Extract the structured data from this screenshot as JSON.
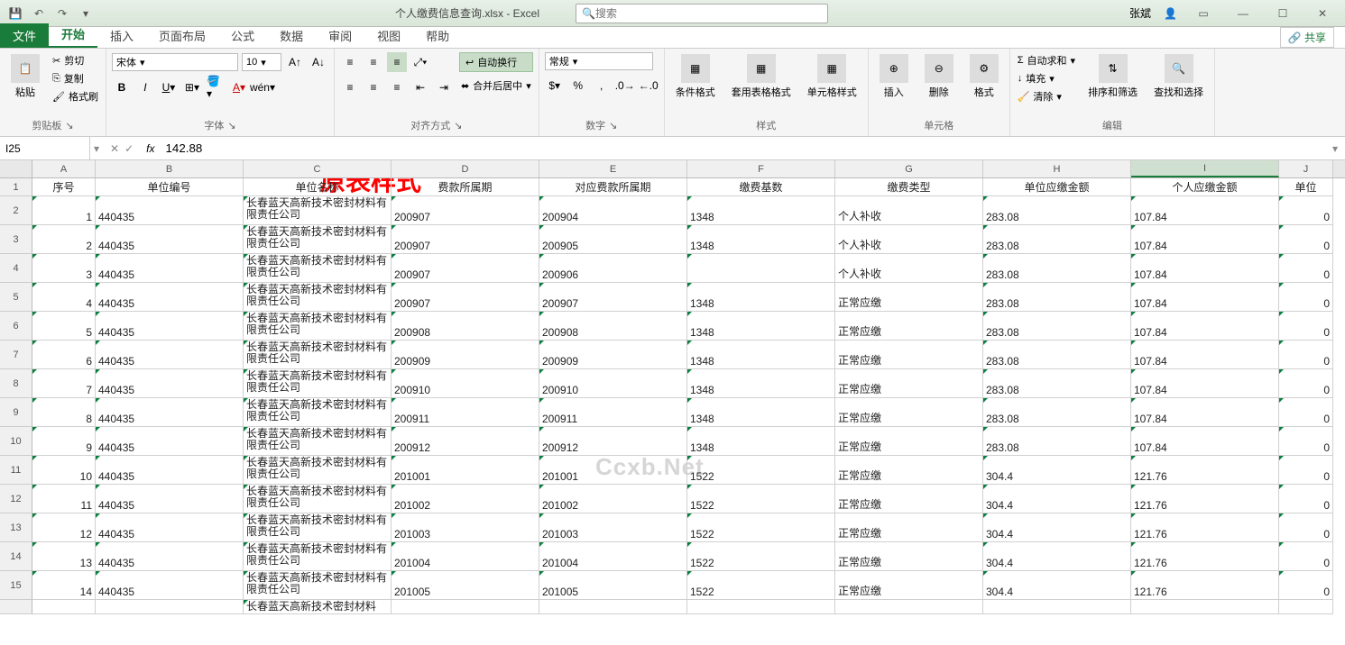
{
  "title": "个人缴费信息查询.xlsx - Excel",
  "search_placeholder": "搜索",
  "user_name": "张斌",
  "annotation": "原表样式",
  "watermark": "Ccxb.Net",
  "name_box": "I25",
  "formula_value": "142.88",
  "tabs": {
    "file": "文件",
    "home": "开始",
    "insert": "插入",
    "layout": "页面布局",
    "formula": "公式",
    "data": "数据",
    "review": "审阅",
    "view": "视图",
    "help": "帮助"
  },
  "share": "共享",
  "clipboard": {
    "paste": "粘贴",
    "cut": "剪切",
    "copy": "复制",
    "painter": "格式刷",
    "label": "剪贴板"
  },
  "font": {
    "name": "宋体",
    "size": "10",
    "label": "字体"
  },
  "align": {
    "wrap": "自动换行",
    "merge": "合并后居中",
    "label": "对齐方式"
  },
  "number": {
    "format": "常规",
    "label": "数字"
  },
  "styles": {
    "cond": "条件格式",
    "table": "套用表格格式",
    "cell": "单元格样式",
    "label": "样式"
  },
  "cells": {
    "insert": "插入",
    "delete": "删除",
    "format": "格式",
    "label": "单元格"
  },
  "editing": {
    "sum": "自动求和",
    "fill": "填充",
    "clear": "清除",
    "sort": "排序和筛选",
    "find": "查找和选择",
    "label": "编辑"
  },
  "columns": [
    "A",
    "B",
    "C",
    "D",
    "E",
    "F",
    "G",
    "H",
    "I",
    "J"
  ],
  "headers": {
    "A": "序号",
    "B": "单位编号",
    "C": "单位名称",
    "D": "费款所属期",
    "E": "对应费款所属期",
    "F": "缴费基数",
    "G": "缴费类型",
    "H": "单位应缴金额",
    "I": "个人应缴金额",
    "J": "单位"
  },
  "company": "长春蓝天高新技术密封材料有限责任公司",
  "rows": [
    {
      "n": 1,
      "A": "1",
      "B": "440435",
      "D": "200907",
      "E": "200904",
      "F": "1348",
      "G": "个人补收",
      "H": "283.08",
      "I": "107.84",
      "J": "0"
    },
    {
      "n": 2,
      "A": "2",
      "B": "440435",
      "D": "200907",
      "E": "200905",
      "F": "1348",
      "G": "个人补收",
      "H": "283.08",
      "I": "107.84",
      "J": "0"
    },
    {
      "n": 3,
      "A": "3",
      "B": "440435",
      "D": "200907",
      "E": "200906",
      "F": "",
      "G": "个人补收",
      "H": "283.08",
      "I": "107.84",
      "J": "0"
    },
    {
      "n": 4,
      "A": "4",
      "B": "440435",
      "D": "200907",
      "E": "200907",
      "F": "1348",
      "G": "正常应缴",
      "H": "283.08",
      "I": "107.84",
      "J": "0"
    },
    {
      "n": 5,
      "A": "5",
      "B": "440435",
      "D": "200908",
      "E": "200908",
      "F": "1348",
      "G": "正常应缴",
      "H": "283.08",
      "I": "107.84",
      "J": "0"
    },
    {
      "n": 6,
      "A": "6",
      "B": "440435",
      "D": "200909",
      "E": "200909",
      "F": "1348",
      "G": "正常应缴",
      "H": "283.08",
      "I": "107.84",
      "J": "0"
    },
    {
      "n": 7,
      "A": "7",
      "B": "440435",
      "D": "200910",
      "E": "200910",
      "F": "1348",
      "G": "正常应缴",
      "H": "283.08",
      "I": "107.84",
      "J": "0"
    },
    {
      "n": 8,
      "A": "8",
      "B": "440435",
      "D": "200911",
      "E": "200911",
      "F": "1348",
      "G": "正常应缴",
      "H": "283.08",
      "I": "107.84",
      "J": "0"
    },
    {
      "n": 9,
      "A": "9",
      "B": "440435",
      "D": "200912",
      "E": "200912",
      "F": "1348",
      "G": "正常应缴",
      "H": "283.08",
      "I": "107.84",
      "J": "0"
    },
    {
      "n": 10,
      "A": "10",
      "B": "440435",
      "D": "201001",
      "E": "201001",
      "F": "1522",
      "G": "正常应缴",
      "H": "304.4",
      "I": "121.76",
      "J": "0"
    },
    {
      "n": 11,
      "A": "11",
      "B": "440435",
      "D": "201002",
      "E": "201002",
      "F": "1522",
      "G": "正常应缴",
      "H": "304.4",
      "I": "121.76",
      "J": "0"
    },
    {
      "n": 12,
      "A": "12",
      "B": "440435",
      "D": "201003",
      "E": "201003",
      "F": "1522",
      "G": "正常应缴",
      "H": "304.4",
      "I": "121.76",
      "J": "0"
    },
    {
      "n": 13,
      "A": "13",
      "B": "440435",
      "D": "201004",
      "E": "201004",
      "F": "1522",
      "G": "正常应缴",
      "H": "304.4",
      "I": "121.76",
      "J": "0"
    },
    {
      "n": 14,
      "A": "14",
      "B": "440435",
      "D": "201005",
      "E": "201005",
      "F": "1522",
      "G": "正常应缴",
      "H": "304.4",
      "I": "121.76",
      "J": "0"
    }
  ],
  "partial_row": "长春蓝天高新技术密封材料"
}
